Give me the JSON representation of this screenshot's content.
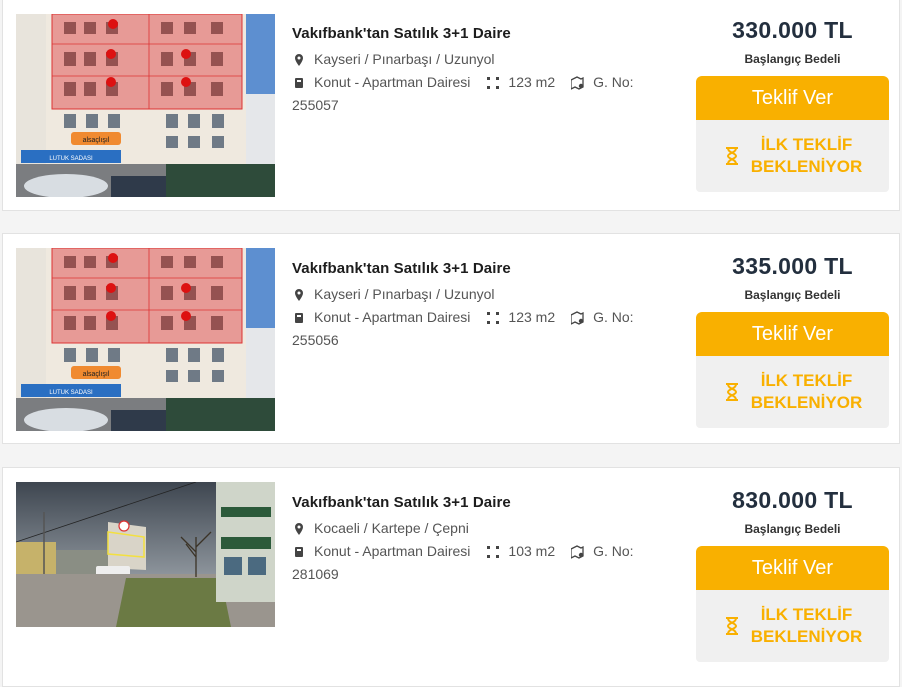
{
  "listings": [
    {
      "title": "Vakıfbank'tan Satılık 3+1 Daire",
      "location": "Kayseri / Pınarbaşı / Uzunyol",
      "type": "Konut - Apartman Dairesi",
      "area": "123 m2",
      "gno_label": "G. No:",
      "gno_value": "255057",
      "price": "330.000 TL",
      "price_label": "Başlangıç Bedeli",
      "bid_label": "Teklif Ver",
      "status_line1": "İLK TEKLİF",
      "status_line2": "BEKLENİYOR",
      "image": "building-photo"
    },
    {
      "title": "Vakıfbank'tan Satılık 3+1 Daire",
      "location": "Kayseri / Pınarbaşı / Uzunyol",
      "type": "Konut - Apartman Dairesi",
      "area": "123 m2",
      "gno_label": "G. No:",
      "gno_value": "255056",
      "price": "335.000 TL",
      "price_label": "Başlangıç Bedeli",
      "bid_label": "Teklif Ver",
      "status_line1": "İLK TEKLİF",
      "status_line2": "BEKLENİYOR",
      "image": "building-photo"
    },
    {
      "title": "Vakıfbank'tan Satılık 3+1 Daire",
      "location": "Kocaeli / Kartepe / Çepni",
      "type": "Konut - Apartman Dairesi",
      "area": "103 m2",
      "gno_label": "G. No:",
      "gno_value": "281069",
      "price": "830.000 TL",
      "price_label": "Başlangıç Bedeli",
      "bid_label": "Teklif Ver",
      "status_line1": "İLK TEKLİF",
      "status_line2": "BEKLENİYOR",
      "image": "street-photo"
    }
  ],
  "colors": {
    "accent": "#f9b000",
    "price": "#232f3e",
    "status_bg": "#f0f0f0"
  },
  "photo_labels": {
    "sign": "alsaçlışıl",
    "shop": "LUTUK SADASI"
  }
}
